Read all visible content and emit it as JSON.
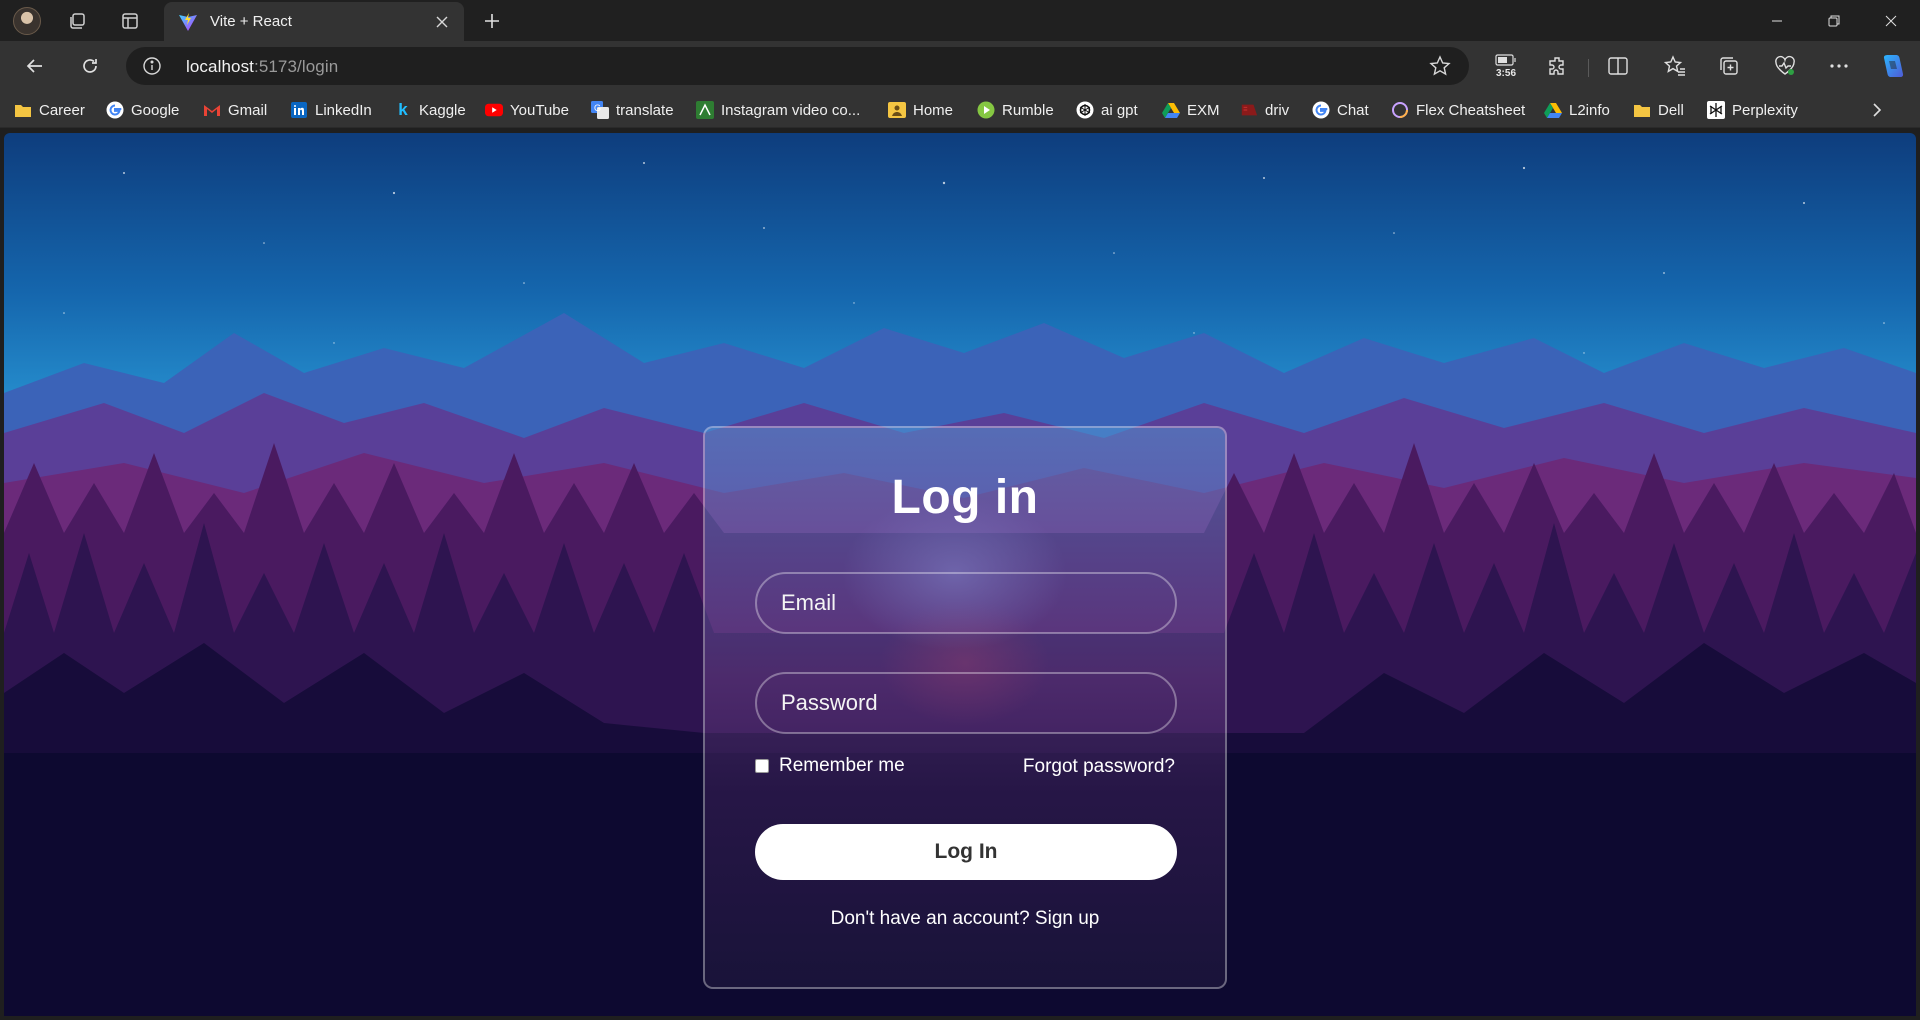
{
  "browser": {
    "tab": {
      "title": "Vite + React",
      "favicon": "vite-icon"
    },
    "address": {
      "host": "localhost",
      "path": ":5173/login"
    },
    "battery_time": "3:56",
    "icons": [
      "profile-avatar",
      "workspaces-icon",
      "tab-actions-icon",
      "close-icon",
      "plus-icon",
      "minimize-icon",
      "restore-icon",
      "window-close-icon",
      "back-arrow-icon",
      "reload-icon",
      "info-icon",
      "star-icon",
      "battery-icon",
      "extensions-icon",
      "split-screen-icon",
      "favorites-icon",
      "collections-icon",
      "browser-essentials-icon",
      "more-icon",
      "copilot-icon",
      "chevron-right-icon"
    ]
  },
  "bookmarks": [
    {
      "label": "Career",
      "icon": "folder-icon"
    },
    {
      "label": "Google",
      "icon": "google-icon"
    },
    {
      "label": "Gmail",
      "icon": "gmail-icon"
    },
    {
      "label": "LinkedIn",
      "icon": "linkedin-icon"
    },
    {
      "label": "Kaggle",
      "icon": "kaggle-icon"
    },
    {
      "label": "YouTube",
      "icon": "youtube-icon"
    },
    {
      "label": "translate",
      "icon": "translate-icon"
    },
    {
      "label": "Instagram video co...",
      "icon": "instagram-video-icon"
    },
    {
      "label": "Home",
      "icon": "home-icon"
    },
    {
      "label": "Rumble",
      "icon": "rumble-icon"
    },
    {
      "label": "ai gpt",
      "icon": "openai-icon"
    },
    {
      "label": "EXM",
      "icon": "drive-icon"
    },
    {
      "label": "driv",
      "icon": "drive-red-icon"
    },
    {
      "label": "Chat",
      "icon": "google-icon"
    },
    {
      "label": "Flex Cheatsheet",
      "icon": "ring-icon"
    },
    {
      "label": "L2info",
      "icon": "drive-icon"
    },
    {
      "label": "Dell",
      "icon": "folder-icon"
    },
    {
      "label": "Perplexity",
      "icon": "perplexity-icon"
    }
  ],
  "login": {
    "title": "Log in",
    "email_placeholder": "Email",
    "password_placeholder": "Password",
    "remember_label": "Remember me",
    "forgot_label": "Forgot password?",
    "submit_label": "Log In",
    "signup_text": "Don't have an account? Sign up"
  },
  "colors": {
    "chrome": "#202020",
    "toolbar": "#333333",
    "omnibox": "#1f1f1f",
    "card_border": "rgba(255,255,255,0.35)",
    "button_bg": "#ffffff"
  }
}
